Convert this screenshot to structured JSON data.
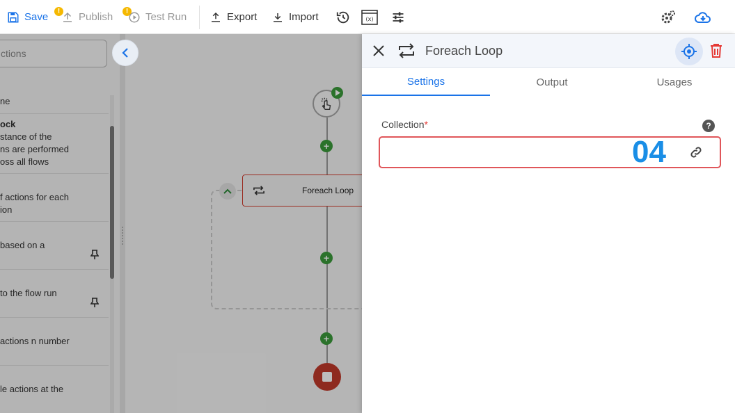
{
  "toolbar": {
    "save": "Save",
    "publish": "Publish",
    "test_run": "Test Run",
    "export": "Export",
    "import": "Import",
    "warning_badge": "!"
  },
  "actions_panel": {
    "search_placeholder": "ctions",
    "items": [
      {
        "lines": [
          "ne"
        ]
      },
      {
        "title": "ock",
        "lines": [
          "stance of the",
          "ns are performed",
          "oss all flows"
        ]
      },
      {
        "lines": [
          "f actions for each",
          "ion"
        ]
      },
      {
        "lines": [
          "based on a"
        ],
        "pinned": true
      },
      {
        "lines": [
          "to the flow run"
        ],
        "pinned": true
      },
      {
        "lines": [
          "actions n number"
        ]
      },
      {
        "lines": [
          "le actions at the"
        ]
      }
    ]
  },
  "canvas": {
    "loop_node_label": "Foreach Loop",
    "plus": "+"
  },
  "settings": {
    "title": "Foreach Loop",
    "tabs": [
      "Settings",
      "Output",
      "Usages"
    ],
    "active_tab": "Settings",
    "field_label": "Collection",
    "required_mark": "*",
    "help": "?",
    "badge": "04"
  },
  "colors": {
    "primary": "#1a73e8",
    "warning": "#f5b800",
    "success": "#3a9a3a",
    "danger": "#e53935",
    "badge": "#1a8ee6"
  }
}
